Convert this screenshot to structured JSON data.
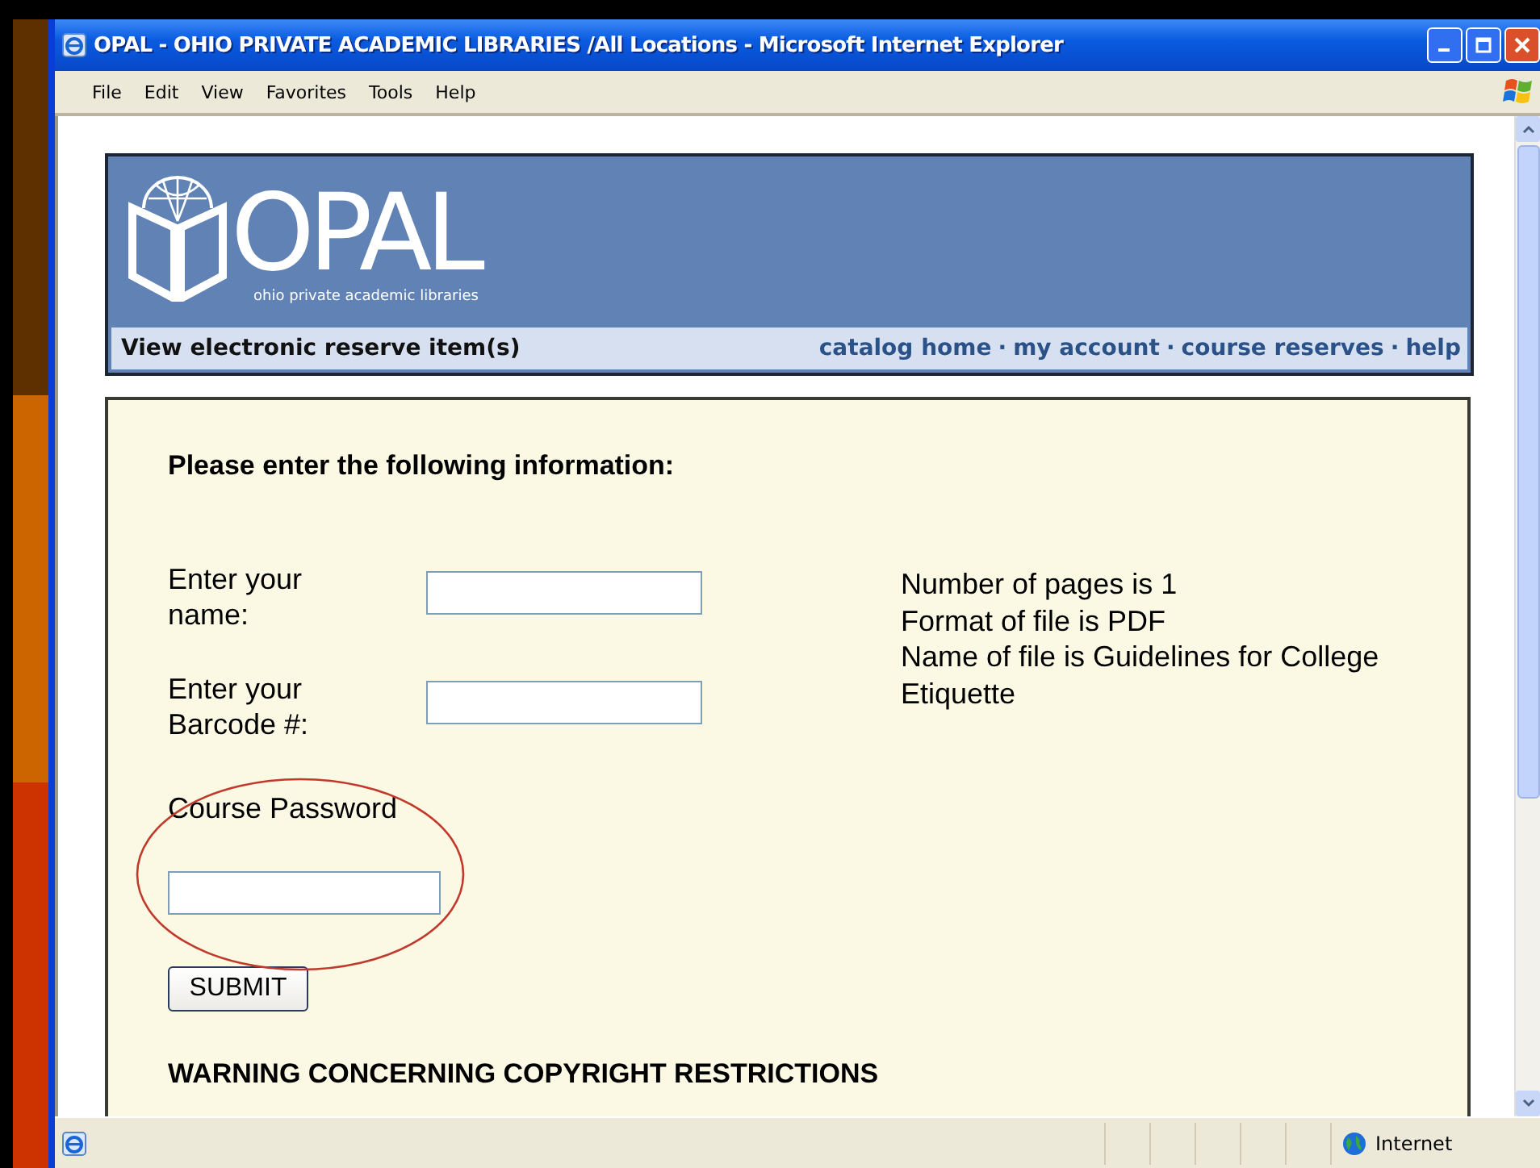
{
  "window": {
    "title": "OPAL - OHIO PRIVATE ACADEMIC LIBRARIES /All Locations - Microsoft Internet Explorer"
  },
  "menu": [
    "File",
    "Edit",
    "View",
    "Favorites",
    "Tools",
    "Help"
  ],
  "header": {
    "logo": "OPAL",
    "tagline": "ohio private academic libraries",
    "page_title": "View electronic reserve item(s)",
    "nav_separator": "·",
    "nav": [
      "catalog home",
      "my account",
      "course reserves",
      "help"
    ]
  },
  "form": {
    "heading": "Please enter the following information:",
    "fields": [
      {
        "label": "Enter your name:",
        "kind": "inline"
      },
      {
        "label": "Enter your Barcode #:",
        "kind": "inline"
      },
      {
        "label": "Course Password",
        "kind": "stacked"
      }
    ],
    "submit": "SUBMIT",
    "info": [
      "Number of pages is 1",
      "Format of file is PDF",
      "Name of file is Guidelines for College Etiquette"
    ],
    "warning": "WARNING CONCERNING COPYRIGHT RESTRICTIONS",
    "annotation": {
      "kind": "ellipse"
    }
  },
  "status_bar": {
    "zone": "Internet"
  }
}
